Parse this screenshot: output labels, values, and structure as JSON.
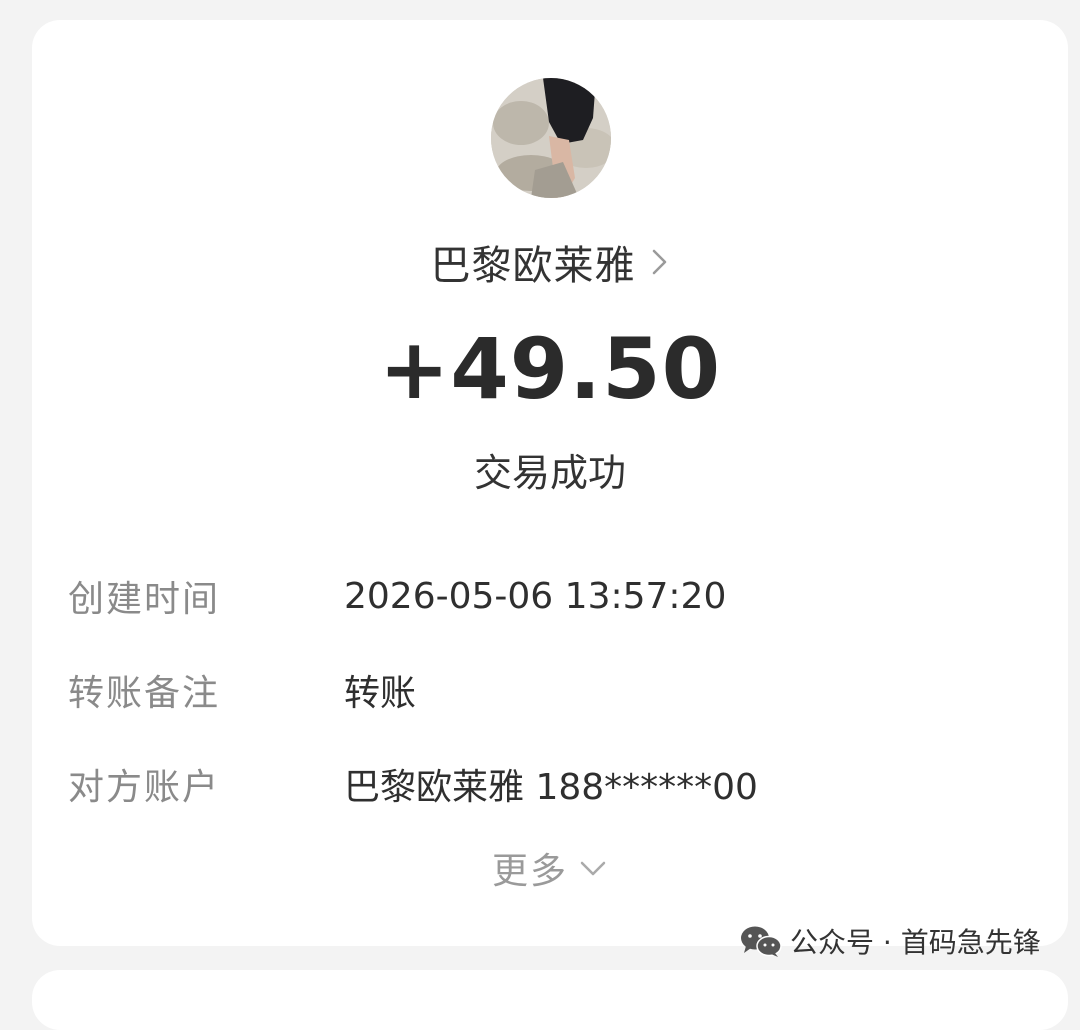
{
  "payee": {
    "name": "巴黎欧莱雅"
  },
  "transaction": {
    "amount": "+49.50",
    "status": "交易成功"
  },
  "details": [
    {
      "label": "创建时间",
      "value": "2026-05-06 13:57:20"
    },
    {
      "label": "转账备注",
      "value": "转账"
    },
    {
      "label": "对方账户",
      "value": "巴黎欧莱雅 188******00"
    }
  ],
  "more": {
    "label": "更多"
  },
  "watermark": {
    "text": "公众号 · 首码急先锋"
  },
  "icons": {
    "avatar": "avatar-photo",
    "name_chevron": "chevron-right-icon",
    "more_chevron": "chevron-down-icon",
    "watermark": "wechat-icon"
  },
  "colors": {
    "background": "#f3f3f3",
    "card": "#ffffff",
    "primary_text": "#333333",
    "secondary_text": "#8a8a8a"
  }
}
